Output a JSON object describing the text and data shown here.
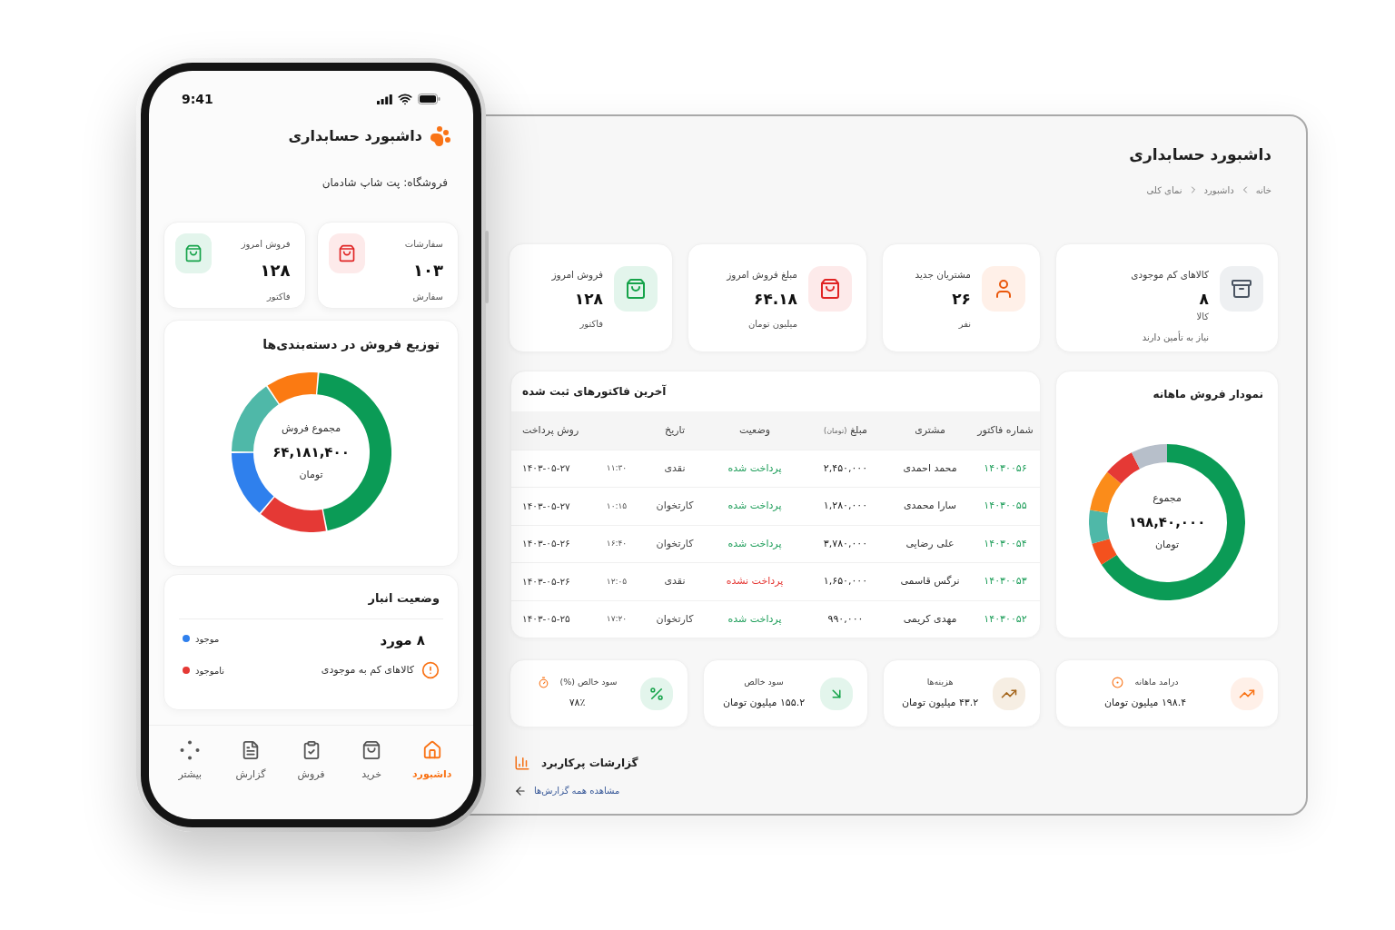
{
  "phone": {
    "status_bar": {
      "time": "9:41"
    },
    "title": "داشبورد حسابداری",
    "store": "فروشگاه: پت شاپ شادمان",
    "stats": [
      {
        "kind": "orders",
        "label": "سفارشات",
        "value": "۱۰۳",
        "unit": "سفارش"
      },
      {
        "kind": "sales",
        "label": "فروش امروز",
        "value": "۱۲۸",
        "unit": "فاکتور"
      }
    ],
    "category_chart": {
      "title": "توزیع فروش در دسته‌بندی‌ها",
      "center_label": "مجموع فروش",
      "center_value": "۶۴,۱۸۱,۴۰۰",
      "center_unit": "تومان"
    },
    "inventory": {
      "title": "وضعیت انبار",
      "count": "۸ مورد",
      "warning": "کالاهای کم به موجودی",
      "legend": [
        {
          "label": "موجود",
          "color": "#2f80ed"
        },
        {
          "label": "ناموجود",
          "color": "#e53935"
        }
      ]
    },
    "nav": [
      {
        "kind": "home",
        "label": "داشبورد",
        "selected": true
      },
      {
        "kind": "purchase",
        "label": "خرید",
        "selected": false
      },
      {
        "kind": "sales",
        "label": "فروش",
        "selected": false
      },
      {
        "kind": "report",
        "label": "گزارش",
        "selected": false
      },
      {
        "kind": "more",
        "label": "بیشتر",
        "selected": false
      }
    ]
  },
  "dashboard": {
    "title": "داشبورد حسابداری",
    "breadcrumb": [
      "خانه",
      "داشبورد",
      "نمای کلی"
    ],
    "kpis": [
      {
        "kind": "stock",
        "label": "کالاهای کم موجودی",
        "value": "۸",
        "unit": "کالا",
        "note": "نیاز به تأمین دارند"
      },
      {
        "kind": "customers",
        "label": "مشتریان جدید",
        "value": "۲۶",
        "unit": "نفر"
      },
      {
        "kind": "revenue",
        "label": "مبلغ فروش امروز",
        "value": "۶۴.۱۸",
        "unit": "میلیون تومان"
      },
      {
        "kind": "sales",
        "label": "فروش امروز",
        "value": "۱۲۸",
        "unit": "فاکتور"
      }
    ],
    "monthly_chart": {
      "title": "نمودار فروش ماهانه",
      "center_label": "مجموع",
      "center_value": "۱۹۸,۴۰,۰۰۰",
      "center_unit": "تومان"
    },
    "invoices": {
      "title": "آخرین فاکتورهای ثبت شده",
      "columns": [
        {
          "label": "شماره فاکتور"
        },
        {
          "label": "مشتری"
        },
        {
          "label": "مبلغ",
          "unit": "(تومان)"
        },
        {
          "label": "وضعیت"
        },
        {
          "label": "تاریخ"
        },
        {
          "label": "روش پرداخت"
        }
      ],
      "rows": [
        {
          "number": "۱۴۰۳۰۰۵۶",
          "customer": "محمد احمدی",
          "amount": "۲,۴۵۰,۰۰۰",
          "status": "پرداخت شده",
          "paid": true,
          "method": "نقدی",
          "time": "۱۱:۳۰",
          "date": "۱۴۰۳-۰۵-۲۷"
        },
        {
          "number": "۱۴۰۳۰۰۵۵",
          "customer": "سارا محمدی",
          "amount": "۱,۲۸۰,۰۰۰",
          "status": "پرداخت شده",
          "paid": true,
          "method": "کارتخوان",
          "time": "۱۰:۱۵",
          "date": "۱۴۰۳-۰۵-۲۷"
        },
        {
          "number": "۱۴۰۳۰۰۵۴",
          "customer": "علی رضایی",
          "amount": "۳,۷۸۰,۰۰۰",
          "status": "پرداخت شده",
          "paid": true,
          "method": "کارتخوان",
          "time": "۱۶:۴۰",
          "date": "۱۴۰۳-۰۵-۲۶"
        },
        {
          "number": "۱۴۰۳۰۰۵۳",
          "customer": "نرگس قاسمی",
          "amount": "۱,۶۵۰,۰۰۰",
          "status": "پرداخت نشده",
          "paid": false,
          "method": "نقدی",
          "time": "۱۲:۰۵",
          "date": "۱۴۰۳-۰۵-۲۶"
        },
        {
          "number": "۱۴۰۳۰۰۵۲",
          "customer": "مهدی کریمی",
          "amount": "۹۹۰,۰۰۰",
          "status": "پرداخت شده",
          "paid": true,
          "method": "کارتخوان",
          "time": "۱۷:۲۰",
          "date": "۱۴۰۳-۰۵-۲۵"
        }
      ]
    },
    "summary": [
      {
        "kind": "income",
        "label": "درامد ماهانه",
        "value": "۱۹۸.۴ میلیون تومان"
      },
      {
        "kind": "expenses",
        "label": "هزینه‌ها",
        "value": "۴۳.۲ میلیون تومان"
      },
      {
        "kind": "profit",
        "label": "سود خالص",
        "value": "۱۵۵.۲ میلیون تومان"
      },
      {
        "kind": "margin",
        "label": "سود خالص (%)",
        "value": "۷۸٪"
      }
    ],
    "reports": {
      "title": "گزارشات پرکاربرد",
      "link": "مشاهده همه گزارش‌ها"
    }
  }
}
